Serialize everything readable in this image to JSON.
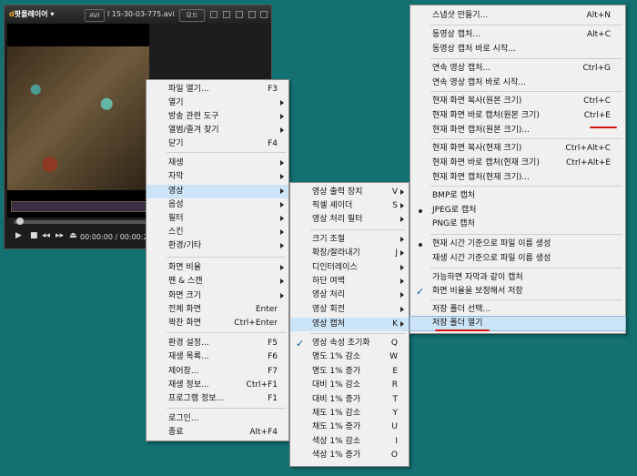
{
  "player": {
    "logo_brand": "d",
    "logo_text": "팟플레이어",
    "format": "AVI",
    "filename": "l 15-30-03-775.avi",
    "mode_button": "모드",
    "time": "00:00:00 / 00:00:24"
  },
  "main_menu": [
    {
      "label": "파일 열기...",
      "shortcut": "F3"
    },
    {
      "label": "열기",
      "arrow": true
    },
    {
      "label": "방송 관련 도구",
      "arrow": true
    },
    {
      "label": "열범/즐겨 찾기",
      "arrow": true
    },
    {
      "label": "닫기",
      "shortcut": "F4"
    },
    {
      "label": "재생",
      "arrow": true
    },
    {
      "label": "자막",
      "arrow": true
    },
    {
      "label": "영상",
      "arrow": true,
      "highlight": true
    },
    {
      "label": "음성",
      "arrow": true
    },
    {
      "label": "필터",
      "arrow": true
    },
    {
      "label": "스킨",
      "arrow": true
    },
    {
      "label": "환경/기타",
      "arrow": true
    },
    {
      "label": "화면 비율",
      "arrow": true
    },
    {
      "label": "팬 & 스캔",
      "arrow": true
    },
    {
      "label": "화면 크기",
      "arrow": true
    },
    {
      "label": "전체 화면",
      "shortcut": "Enter"
    },
    {
      "label": "꽉찬 화면",
      "shortcut": "Ctrl+Enter"
    },
    {
      "label": "환경 설정...",
      "shortcut": "F5"
    },
    {
      "label": "재생 목록...",
      "shortcut": "F6"
    },
    {
      "label": "제어창...",
      "shortcut": "F7"
    },
    {
      "label": "재생 정보...",
      "shortcut": "Ctrl+F1"
    },
    {
      "label": "프로그램 정보...",
      "shortcut": "F1"
    },
    {
      "label": "로그인..."
    },
    {
      "label": "종료",
      "shortcut": "Alt+F4"
    }
  ],
  "video_menu": [
    {
      "label": "영상 출력 장치",
      "shortcut": "V",
      "arrow": true
    },
    {
      "label": "픽셀 셰이더",
      "shortcut": "S",
      "arrow": true
    },
    {
      "label": "영상 처리 필터",
      "arrow": true
    },
    {
      "label": "크기 조절",
      "arrow": true
    },
    {
      "label": "확장/잘라내기",
      "shortcut": "J",
      "arrow": true
    },
    {
      "label": "디인터레이스",
      "arrow": true
    },
    {
      "label": "하단 여백",
      "arrow": true
    },
    {
      "label": "영상 처리",
      "arrow": true
    },
    {
      "label": "영상 회전",
      "arrow": true
    },
    {
      "label": "영상 캡처",
      "shortcut": "K",
      "arrow": true,
      "highlight": true
    },
    {
      "label": "영상 속성 초기화",
      "shortcut": "Q",
      "check": true
    },
    {
      "label": "명도 1% 감소",
      "shortcut": "W"
    },
    {
      "label": "명도 1% 증가",
      "shortcut": "E"
    },
    {
      "label": "대비 1% 감소",
      "shortcut": "R"
    },
    {
      "label": "대비 1% 증가",
      "shortcut": "T"
    },
    {
      "label": "채도 1% 감소",
      "shortcut": "Y"
    },
    {
      "label": "채도 1% 증가",
      "shortcut": "U"
    },
    {
      "label": "색상 1% 감소",
      "shortcut": "I"
    },
    {
      "label": "색상 1% 증가",
      "shortcut": "O"
    }
  ],
  "capture_menu": [
    {
      "label": "스냅샷 만들기...",
      "shortcut": "Alt+N"
    },
    {
      "label": "동영상 캡처...",
      "shortcut": "Alt+C"
    },
    {
      "label": "동영상 캡처 바로 시작..."
    },
    {
      "label": "연속 영상 캡처...",
      "shortcut": "Ctrl+G"
    },
    {
      "label": "연속 영상 캡처 바로 시작..."
    },
    {
      "label": "현재 화면 복사(원본 크기)",
      "shortcut": "Ctrl+C"
    },
    {
      "label": "현재 화면 바로 캡처(원본 크기)",
      "shortcut": "Ctrl+E"
    },
    {
      "label": "현재 화면 캡처(원본 크기)..."
    },
    {
      "label": "현재 화면 복사(현재 크기)",
      "shortcut": "Ctrl+Alt+C"
    },
    {
      "label": "현재 화면 바로 캡처(현재 크기)",
      "shortcut": "Ctrl+Alt+E"
    },
    {
      "label": "현재 화면 캡처(현재 크기)..."
    },
    {
      "label": "BMP로 캡처"
    },
    {
      "label": "JPEG로 캡처",
      "bullet": true
    },
    {
      "label": "PNG로 캡처"
    },
    {
      "label": "현재 시간 기준으로 파일 이름 생성",
      "bullet": true
    },
    {
      "label": "재생 시간 기준으로 파일 이름 생성"
    },
    {
      "label": "가능하면 자막과 같이 캡처"
    },
    {
      "label": "화면 비율을 보정해서 저장",
      "check": true
    },
    {
      "label": "저장 폴더 선택..."
    },
    {
      "label": "저장 폴더 열기",
      "highlight": true
    }
  ]
}
